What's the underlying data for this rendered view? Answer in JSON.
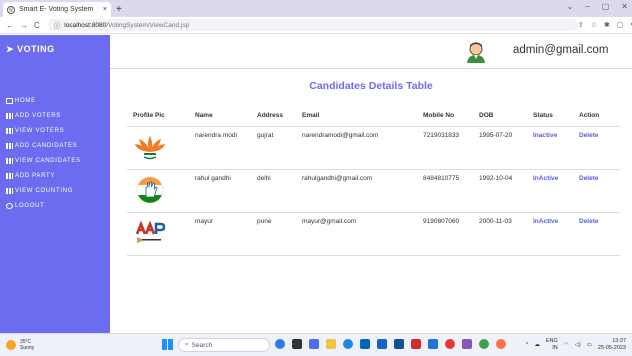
{
  "browser": {
    "tab_title": "Smart E- Voting System",
    "tab_close": "×",
    "new_tab": "+",
    "window_controls": [
      "⌄",
      "–",
      "▢",
      "✕"
    ],
    "nav_icons": [
      "←",
      "→",
      "C"
    ],
    "url_host": "localhost:8080",
    "url_path": "/VotingSystem/ViewCand.jsp",
    "toolbar_icons": [
      "⇪",
      "☆",
      "✱",
      "▢",
      "●",
      "⋮"
    ]
  },
  "sidebar": {
    "brand": "VOTING",
    "items": [
      {
        "label": "HOME",
        "icon": "home-icon"
      },
      {
        "label": "ADD VOTERS",
        "icon": "chart-icon"
      },
      {
        "label": "VIEW VOTERS",
        "icon": "chart-icon"
      },
      {
        "label": "ADD CANDIDATES",
        "icon": "chart-icon"
      },
      {
        "label": "VIEW CANDIDATES",
        "icon": "chart-icon"
      },
      {
        "label": "ADD PARTY",
        "icon": "chart-icon"
      },
      {
        "label": "VIEW COUNTING",
        "icon": "chart-icon"
      },
      {
        "label": "LOGOUT",
        "icon": "logout-icon"
      }
    ]
  },
  "header": {
    "user": "admin@gmail.com"
  },
  "page": {
    "heading": "Candidates Details Table"
  },
  "table": {
    "columns": [
      "Profile Pic",
      "Name",
      "Address",
      "Email",
      "Mobile No",
      "DOB",
      "Status",
      "Action"
    ],
    "rows": [
      {
        "pic": "bjp-lotus-logo",
        "name": "narendra modi",
        "address": "gujrat",
        "email": "narendramodi@gmail.com",
        "mobile": "7219031833",
        "dob": "1995-07-20",
        "status": "Inactive",
        "action": "Delete"
      },
      {
        "pic": "congress-hand-logo",
        "name": "rahul gandhi",
        "address": "delhi",
        "email": "rahulgandhi@gmail.com",
        "mobile": "8484810775",
        "dob": "1992-10-04",
        "status": "InActive",
        "action": "Delete"
      },
      {
        "pic": "aap-broom-logo",
        "name": "mayur",
        "address": "pune",
        "email": "mayur@gmail.com",
        "mobile": "9190807060",
        "dob": "2000-11-03",
        "status": "InActive",
        "action": "Delete"
      }
    ]
  },
  "taskbar": {
    "temperature": "35°C",
    "weather": "Sunny",
    "search_placeholder": "Search",
    "lang_top": "ENG",
    "lang_bottom": "IN",
    "time": "13:37",
    "date": "25-05-2023"
  },
  "colors": {
    "accent": "#6c6cf0",
    "status": "#5a5ae6"
  }
}
